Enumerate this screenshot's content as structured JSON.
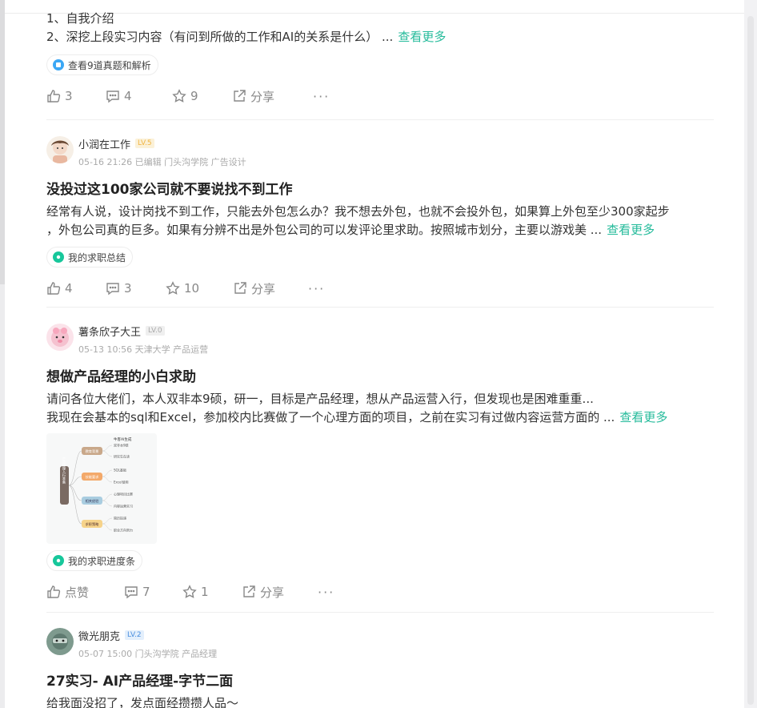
{
  "post1": {
    "lines": [
      "1、自我介绍",
      "2、深挖上段实习内容（有问到所做的工作和AI的关系是什么） ..."
    ],
    "more": "查看更多",
    "chip": "查看9道真题和解析",
    "likes": "3",
    "comments": "4",
    "stars": "9",
    "share": "分享"
  },
  "post2": {
    "author": "小润在工作",
    "level": "LV.5",
    "meta": "05-16 21:26  已编辑  门头沟学院 广告设计",
    "title": "没投过这100家公司就不要说找不到工作",
    "lines": [
      "经常有人说，设计岗找不到工作，只能去外包怎么办？我不想去外包，也就不会投外包，如果算上外包至少300家起步",
      "，外包公司真的巨多。如果有分辨不出是外包公司的可以发评论里求助。按照城市划分，主要以游戏美 ..."
    ],
    "more": "查看更多",
    "chip": "我的求职总结",
    "likes": "4",
    "comments": "3",
    "stars": "10",
    "share": "分享"
  },
  "post3": {
    "author": "薯条欣子大王",
    "level": "LV.0",
    "meta": "05-13 10:56  天津大学 产品运营",
    "title": "想做产品经理的小白求助",
    "lines": [
      "请问各位大佬们，本人双非本9硕，研一，目标是产品经理，想从产品运营入行，但发现也是困难重重...",
      "我现在会基本的sql和Excel，参加校内比赛做了一个心理方面的项目，之前在实习有过做内容运营方面的 ..."
    ],
    "more": "查看更多",
    "chip": "我的求职进度条",
    "likes": "点赞",
    "comments": "7",
    "stars": "1",
    "share": "分享",
    "mindmap": {
      "brand": "牛客AI生成",
      "root": "产品经理入行准备",
      "branches": [
        {
          "label": "教育背景",
          "leaves": [
            "双非本9硕",
            "研究生在读"
          ]
        },
        {
          "label": "技能要求",
          "leaves": [
            "SQL基础",
            "Excel使用"
          ]
        },
        {
          "label": "相关经验",
          "leaves": [
            "心理项目比赛",
            "内容运营实习"
          ]
        },
        {
          "label": "求职策略",
          "leaves": [
            "简历投递",
            "职业方向努力"
          ]
        }
      ]
    }
  },
  "post4": {
    "author": "微光朋克",
    "level": "LV.2",
    "meta": "05-07 15:00  门头沟学院 产品经理",
    "title": "27实习- AI产品经理-字节二面",
    "lines": [
      "给我面没招了，发点面经攒攒人品～"
    ]
  }
}
